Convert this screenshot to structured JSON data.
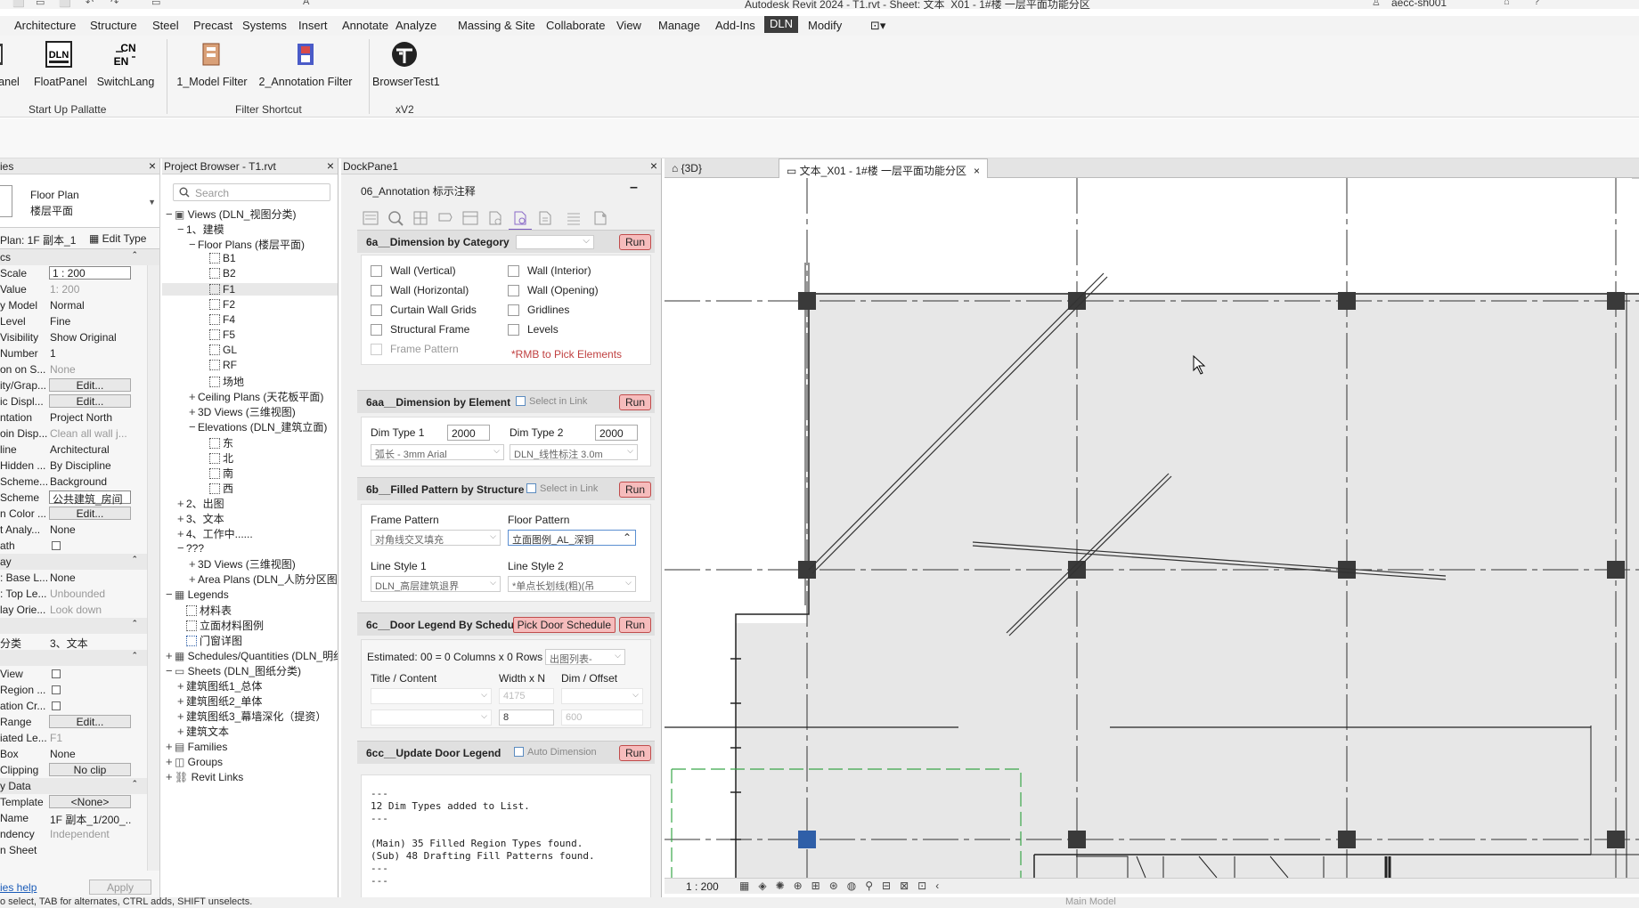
{
  "window": {
    "title": "Autodesk Revit 2024 - T1.rvt - Sheet: 文本_X01 - 1#楼 一层平面功能分区",
    "user": "aecc-sh001"
  },
  "ribbon_tabs": [
    "Architecture",
    "Structure",
    "Steel",
    "Precast",
    "Systems",
    "Insert",
    "Annotate",
    "Analyze",
    "Massing & Site",
    "Collaborate",
    "View",
    "Manage",
    "Add-Ins",
    "DLN",
    "Modify"
  ],
  "ribbon_active": "DLN",
  "ribbon": {
    "buttons": [
      {
        "label": "anel"
      },
      {
        "label": "FloatPanel"
      },
      {
        "label": "SwitchLang",
        "icon_text_top": "CN",
        "icon_text_bottom": "EN"
      },
      {
        "label": "1_Model Filter"
      },
      {
        "label": "2_Annotation Filter"
      },
      {
        "label": "BrowserTest1"
      }
    ],
    "groups": [
      "Start Up Pallatte",
      "Filter Shortcut",
      "xV2"
    ]
  },
  "properties": {
    "title": "ies",
    "type_line1": "Floor Plan",
    "type_line2": "楼层平面",
    "plan_instance": "Plan: 1F 副本_1",
    "edit_type": "Edit Type",
    "rows": [
      {
        "k": "cs",
        "v": "",
        "kind": "sec"
      },
      {
        "k": "Scale",
        "v": "1 : 200",
        "kind": "box"
      },
      {
        "k": "Value",
        "v": "1:  200",
        "kind": "grey"
      },
      {
        "k": "y Model",
        "v": "Normal",
        "kind": "text"
      },
      {
        "k": "Level",
        "v": "Fine",
        "kind": "text"
      },
      {
        "k": "Visibility",
        "v": "Show Original",
        "kind": "text"
      },
      {
        "k": "Number",
        "v": "1",
        "kind": "text"
      },
      {
        "k": "on on S...",
        "v": "None",
        "kind": "grey"
      },
      {
        "k": "ity/Grap...",
        "v": "Edit...",
        "kind": "btn"
      },
      {
        "k": "ic Displ...",
        "v": "Edit...",
        "kind": "btn"
      },
      {
        "k": "ntation",
        "v": "Project North",
        "kind": "text"
      },
      {
        "k": "oin Disp...",
        "v": "Clean all wall j...",
        "kind": "grey"
      },
      {
        "k": "line",
        "v": "Architectural",
        "kind": "text"
      },
      {
        "k": "Hidden ...",
        "v": "By Discipline",
        "kind": "text"
      },
      {
        "k": "Scheme...",
        "v": "Background",
        "kind": "text"
      },
      {
        "k": "Scheme",
        "v": "公共建筑_房间",
        "kind": "box"
      },
      {
        "k": "n Color ...",
        "v": "Edit...",
        "kind": "btn"
      },
      {
        "k": "t Analy...",
        "v": "None",
        "kind": "text"
      },
      {
        "k": "ath",
        "v": "",
        "kind": "chk"
      },
      {
        "k": "ay",
        "v": "",
        "kind": "sec"
      },
      {
        "k": ": Base L...",
        "v": "None",
        "kind": "text"
      },
      {
        "k": ": Top Le...",
        "v": "Unbounded",
        "kind": "grey"
      },
      {
        "k": "lay Orie...",
        "v": "Look down",
        "kind": "grey"
      },
      {
        "k": "",
        "v": "",
        "kind": "sec"
      },
      {
        "k": "分类",
        "v": "3、文本",
        "kind": "text"
      },
      {
        "k": "",
        "v": "",
        "kind": "sec"
      },
      {
        "k": "View",
        "v": "",
        "kind": "chk"
      },
      {
        "k": "Region ...",
        "v": "",
        "kind": "chk"
      },
      {
        "k": "ation Cr...",
        "v": "",
        "kind": "chk"
      },
      {
        "k": "Range",
        "v": "Edit...",
        "kind": "btn"
      },
      {
        "k": "iated Le...",
        "v": "F1",
        "kind": "grey"
      },
      {
        "k": "Box",
        "v": "None",
        "kind": "text"
      },
      {
        "k": "Clipping",
        "v": "No clip",
        "kind": "btn"
      },
      {
        "k": "y Data",
        "v": "",
        "kind": "sec"
      },
      {
        "k": "Template",
        "v": "<None>",
        "kind": "btn"
      },
      {
        "k": "Name",
        "v": "1F 副本_1/200_...",
        "kind": "text"
      },
      {
        "k": "ndency",
        "v": "Independent",
        "kind": "grey"
      },
      {
        "k": "n Sheet",
        "v": "",
        "kind": "text"
      }
    ],
    "help": "ies help",
    "apply": "Apply"
  },
  "browser": {
    "title": "Project Browser - T1.rvt",
    "search_placeholder": "Search",
    "nodes": [
      {
        "d": 0,
        "t": "−",
        "i": "v",
        "l": "Views (DLN_视图分类)"
      },
      {
        "d": 1,
        "t": "−",
        "i": "",
        "l": "1、建模"
      },
      {
        "d": 2,
        "t": "−",
        "i": "",
        "l": "Floor Plans (楼层平面)"
      },
      {
        "d": 3,
        "t": "",
        "i": "b",
        "l": "B1"
      },
      {
        "d": 3,
        "t": "",
        "i": "b",
        "l": "B2"
      },
      {
        "d": 3,
        "t": "",
        "i": "b",
        "l": "F1",
        "sel": true
      },
      {
        "d": 3,
        "t": "",
        "i": "b",
        "l": "F2"
      },
      {
        "d": 3,
        "t": "",
        "i": "b",
        "l": "F4"
      },
      {
        "d": 3,
        "t": "",
        "i": "b",
        "l": "F5"
      },
      {
        "d": 3,
        "t": "",
        "i": "b",
        "l": "GL"
      },
      {
        "d": 3,
        "t": "",
        "i": "b",
        "l": "RF"
      },
      {
        "d": 3,
        "t": "",
        "i": "b",
        "l": "场地"
      },
      {
        "d": 2,
        "t": "+",
        "i": "",
        "l": "Ceiling Plans (天花板平面)"
      },
      {
        "d": 2,
        "t": "+",
        "i": "",
        "l": "3D Views (三维视图)"
      },
      {
        "d": 2,
        "t": "−",
        "i": "",
        "l": "Elevations (DLN_建筑立面)"
      },
      {
        "d": 3,
        "t": "",
        "i": "b",
        "l": "东"
      },
      {
        "d": 3,
        "t": "",
        "i": "b",
        "l": "北"
      },
      {
        "d": 3,
        "t": "",
        "i": "b",
        "l": "南"
      },
      {
        "d": 3,
        "t": "",
        "i": "b",
        "l": "西"
      },
      {
        "d": 1,
        "t": "+",
        "i": "",
        "l": "2、出图"
      },
      {
        "d": 1,
        "t": "+",
        "i": "",
        "l": "3、文本"
      },
      {
        "d": 1,
        "t": "+",
        "i": "",
        "l": "4、工作中......"
      },
      {
        "d": 1,
        "t": "−",
        "i": "",
        "l": "???"
      },
      {
        "d": 2,
        "t": "+",
        "i": "",
        "l": "3D Views (三维视图)"
      },
      {
        "d": 2,
        "t": "+",
        "i": "",
        "l": "Area Plans (DLN_人防分区图)"
      },
      {
        "d": 0,
        "t": "−",
        "i": "l",
        "l": "Legends"
      },
      {
        "d": 1,
        "t": "",
        "i": "b",
        "l": "材料表"
      },
      {
        "d": 1,
        "t": "",
        "i": "b",
        "l": "立面材料图例"
      },
      {
        "d": 1,
        "t": "",
        "i": "b",
        "l": "门窗详图"
      },
      {
        "d": 0,
        "t": "+",
        "i": "s",
        "l": "Schedules/Quantities (DLN_明细表)"
      },
      {
        "d": 0,
        "t": "−",
        "i": "h",
        "l": "Sheets (DLN_图纸分类)"
      },
      {
        "d": 1,
        "t": "+",
        "i": "",
        "l": "建筑图纸1_总体"
      },
      {
        "d": 1,
        "t": "+",
        "i": "",
        "l": "建筑图纸2_单体"
      },
      {
        "d": 1,
        "t": "+",
        "i": "",
        "l": "建筑图纸3_幕墙深化（提资）"
      },
      {
        "d": 1,
        "t": "+",
        "i": "",
        "l": "建筑文本"
      },
      {
        "d": 0,
        "t": "+",
        "i": "f",
        "l": "Families"
      },
      {
        "d": 0,
        "t": "+",
        "i": "g",
        "l": "Groups"
      },
      {
        "d": 0,
        "t": "+",
        "i": "r",
        "l": "Revit Links"
      }
    ]
  },
  "dock": {
    "title": "DockPane1",
    "heading": "06_Annotation 标示注释",
    "run": "Run",
    "s6a": {
      "title": "6a__Dimension by Category",
      "checks_left": [
        "Wall (Vertical)",
        "Wall (Horizontal)",
        "Curtain Wall Grids",
        "Structural Frame",
        "Frame Pattern"
      ],
      "checks_right": [
        "Wall (Interior)",
        "Wall (Opening)",
        "Gridlines",
        "Levels"
      ],
      "rmb": "*RMB to Pick Elements"
    },
    "s6aa": {
      "title": "6aa__Dimension by Element",
      "select_link": "Select in Link",
      "dim1_label": "Dim Type  1",
      "dim1_value": "2000",
      "dim2_label": "Dim Type  2",
      "dim2_value": "2000",
      "dim1_type": "弧长 - 3mm Arial",
      "dim2_type": "DLN_线性标注 3.0m"
    },
    "s6b": {
      "title": "6b__Filled Pattern by Structure",
      "select_link": "Select in Link",
      "frame_label": "Frame Pattern",
      "frame_value": "对角线交叉填充",
      "floor_label": "Floor Pattern",
      "floor_value": "立面图例_AL_深铜",
      "ls1_label": "Line Style  1",
      "ls1_value": "DLN_高层建筑退界",
      "ls2_label": "Line Style  2",
      "ls2_value": "*单点长划线(粗)(吊"
    },
    "s6c": {
      "title": "6c__Door Legend By Schedule",
      "pick": "Pick Door Schedule",
      "estimated": "Estimated:   00 = 0 Columns x 0 Rows",
      "schedule_list": "出图列表-",
      "col1": "Title / Content",
      "col2": "Width x N",
      "col3": "Dim / Offset",
      "width_value": "4175",
      "n_value": "8",
      "offset_value": "600"
    },
    "s6cc": {
      "title": "6cc__Update Door Legend",
      "auto_dim": "Auto Dimension"
    },
    "output": "---\n12 Dim Types added to List.\n---\n\n(Main) 35 Filled Region Types found.\n(Sub) 48 Drafting Fill Patterns found.\n---\n---"
  },
  "view": {
    "tab1": "{3D}",
    "tab2": "文本_X01 - 1#楼 一层平面功能分区",
    "scale": "1 : 200"
  },
  "status": {
    "text": "o select, TAB for alternates, CTRL adds, SHIFT unselects.",
    "model": "Main Model"
  },
  "colors": {
    "ribbon_active": "#3d3d3d",
    "run_button": "#f6bcbc",
    "run_border": "#c04c4c",
    "plan_fill": "#e7e7e7",
    "grid_dash": "#333333",
    "crop_dash": "#3aa64a",
    "link": "#1a5bb8"
  }
}
